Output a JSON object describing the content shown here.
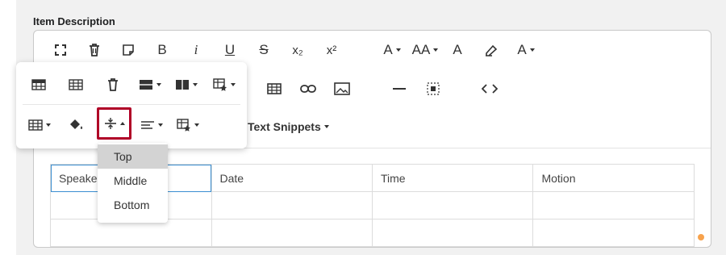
{
  "field": {
    "label": "Item Description"
  },
  "toolbar": {
    "row1": [
      {
        "name": "fullscreen-icon"
      },
      {
        "name": "delete-icon"
      },
      {
        "name": "note-icon"
      },
      {
        "name": "bold-icon",
        "text": "B"
      },
      {
        "name": "italic-icon",
        "text": "i"
      },
      {
        "name": "underline-icon",
        "text": "U"
      },
      {
        "name": "strikethrough-icon",
        "text": "S"
      },
      {
        "name": "subscript-icon",
        "text": "x₂"
      },
      {
        "name": "superscript-icon",
        "text": "x²"
      },
      {
        "name": "font-size-icon",
        "text": "A"
      },
      {
        "name": "text-case-icon",
        "text": "AA"
      },
      {
        "name": "text-color-icon",
        "text": "A"
      },
      {
        "name": "highlight-icon"
      },
      {
        "name": "text-style-icon",
        "text": "A"
      }
    ],
    "row2": [
      {
        "name": "table-icon"
      },
      {
        "name": "link-icon"
      },
      {
        "name": "image-icon"
      },
      {
        "name": "horizontal-line-icon"
      },
      {
        "name": "select-all-icon"
      },
      {
        "name": "code-view-icon"
      }
    ],
    "text_snippets_label": "Text Snippets"
  },
  "table_popup": {
    "row1": [
      {
        "name": "table-header-icon"
      },
      {
        "name": "table-footer-icon"
      },
      {
        "name": "delete-table-icon"
      },
      {
        "name": "table-rows-icon"
      },
      {
        "name": "table-columns-icon"
      },
      {
        "name": "table-style-icon"
      }
    ],
    "row2": [
      {
        "name": "cell-icon"
      },
      {
        "name": "cell-background-icon"
      },
      {
        "name": "vertical-align-icon"
      },
      {
        "name": "horizontal-align-icon"
      },
      {
        "name": "cell-style-icon"
      }
    ]
  },
  "vertical_align_menu": {
    "options": [
      "Top",
      "Middle",
      "Bottom"
    ],
    "selected": "Top"
  },
  "table": {
    "headers": [
      "Speaker",
      "Date",
      "Time",
      "Motion"
    ]
  },
  "colors": {
    "active_border": "#b00027",
    "accent_dot": "#f7a24c",
    "focus_cell": "#3a8ed1"
  }
}
